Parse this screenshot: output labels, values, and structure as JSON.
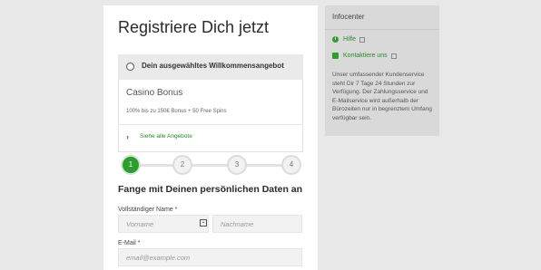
{
  "registration": {
    "title": "Registriere Dich jetzt",
    "offer_header": "Dein ausgewähltes Willkommensangebot",
    "offer_name": "Casino Bonus",
    "offer_description": "100% bis zu 150€ Bonus + 50 Free Spins",
    "all_offers_link": "Siehe alle Angebote",
    "steps": [
      "1",
      "2",
      "3",
      "4"
    ],
    "active_step": 1,
    "section_title": "Fange mit Deinen persönlichen Daten an",
    "full_name_label": "Vollständiger Name *",
    "firstname_placeholder": "Vorname",
    "lastname_placeholder": "Nachname",
    "email_label": "E-Mail *",
    "email_placeholder": "email@example.com"
  },
  "infocenter": {
    "title": "Infocenter",
    "help_link": "Hilfe",
    "contact_link": "Kontaktiere uns",
    "description": "Unser umfassender Kundenservice steht Dir 7 Tage 24 Stunden zur Verfügung. Der Zahlungsservice und E-Mailservice wird außerhalb der Bürozeiten nur in begrenztem Umfang verfügbar sein."
  },
  "colors": {
    "accent": "#2e9d2e",
    "link": "#2a8c2a",
    "background": "#e8e8e8",
    "panel": "#d9d9d9"
  },
  "icons": {
    "help": "info-icon",
    "contact": "chat-icon",
    "external": "external-link-icon",
    "name_field": "id-card-icon",
    "chevron": "chevron-right-icon"
  }
}
